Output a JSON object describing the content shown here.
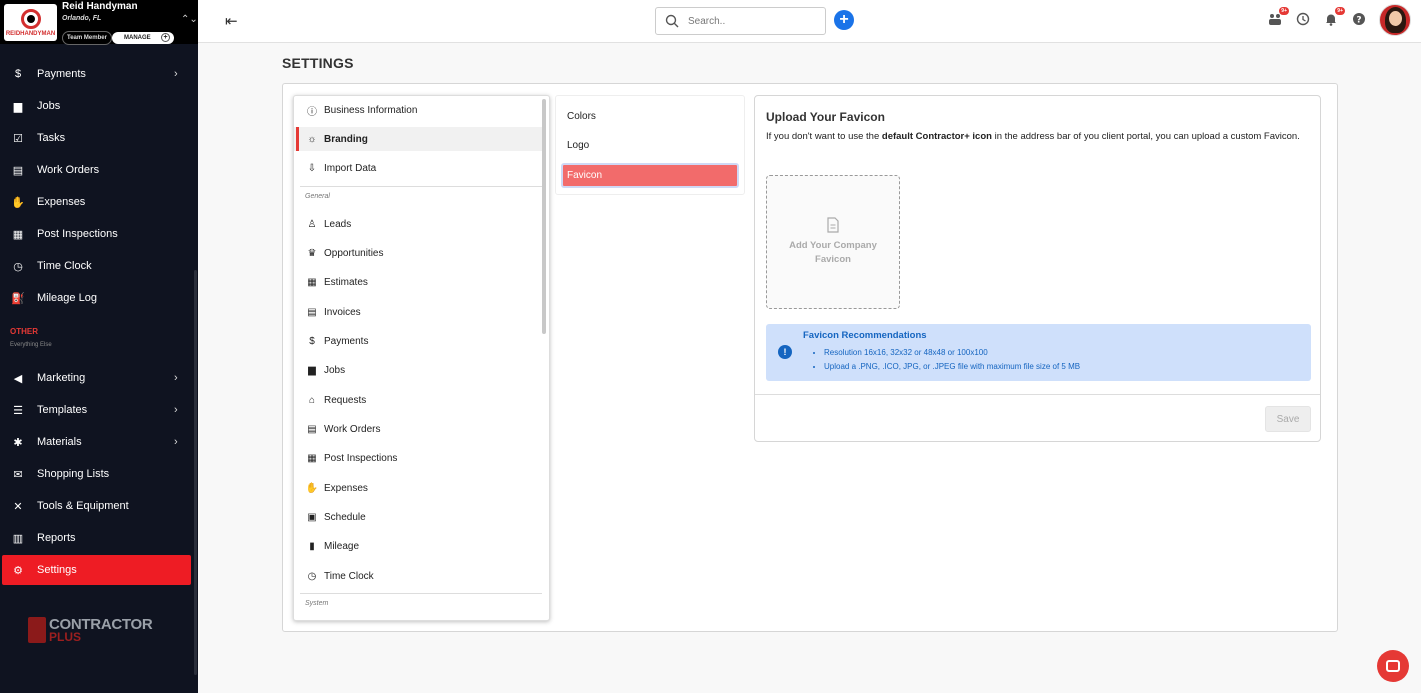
{
  "brand": {
    "name": "Reid Handyman",
    "location": "Orlando, FL",
    "role": "Team Member",
    "manage": "MANAGE",
    "logo_text": "REIDHANDYMAN"
  },
  "sidebar": {
    "items": [
      {
        "label": "Payments",
        "icon": "payments-icon",
        "chevron": true
      },
      {
        "label": "Jobs",
        "icon": "briefcase-icon",
        "chevron": false
      },
      {
        "label": "Tasks",
        "icon": "checklist-icon",
        "chevron": false
      },
      {
        "label": "Work Orders",
        "icon": "work-orders-icon",
        "chevron": false
      },
      {
        "label": "Expenses",
        "icon": "expenses-icon",
        "chevron": false
      },
      {
        "label": "Post Inspections",
        "icon": "inspection-icon",
        "chevron": false
      },
      {
        "label": "Time Clock",
        "icon": "clock-icon",
        "chevron": false
      },
      {
        "label": "Mileage Log",
        "icon": "mileage-icon",
        "chevron": false
      }
    ],
    "other_heading": "OTHER",
    "other_sub": "Everything Else",
    "other_items": [
      {
        "label": "Marketing",
        "icon": "megaphone-icon",
        "chevron": true
      },
      {
        "label": "Templates",
        "icon": "templates-icon",
        "chevron": true
      },
      {
        "label": "Materials",
        "icon": "materials-icon",
        "chevron": true
      },
      {
        "label": "Shopping Lists",
        "icon": "shopping-icon",
        "chevron": false
      },
      {
        "label": "Tools & Equipment",
        "icon": "tools-icon",
        "chevron": false
      },
      {
        "label": "Reports",
        "icon": "reports-icon",
        "chevron": false
      },
      {
        "label": "Settings",
        "icon": "gear-icon",
        "chevron": false,
        "active": true
      }
    ],
    "footer_logo": {
      "line1": "CONTRACTOR",
      "line2": "PLUS"
    }
  },
  "topbar": {
    "search_placeholder": "Search..",
    "badge_1": "9+",
    "badge_2": "9+"
  },
  "page_title": "SETTINGS",
  "settings_menu": {
    "top": [
      {
        "label": "Business Information",
        "icon": "info-icon"
      },
      {
        "label": "Branding",
        "icon": "sun-icon",
        "selected": true
      },
      {
        "label": "Import Data",
        "icon": "import-icon"
      }
    ],
    "general_heading": "General",
    "general": [
      {
        "label": "Leads",
        "icon": "leads-icon"
      },
      {
        "label": "Opportunities",
        "icon": "trophy-icon"
      },
      {
        "label": "Estimates",
        "icon": "calculator-icon"
      },
      {
        "label": "Invoices",
        "icon": "invoice-icon"
      },
      {
        "label": "Payments",
        "icon": "payments-icon"
      },
      {
        "label": "Jobs",
        "icon": "briefcase-icon"
      },
      {
        "label": "Requests",
        "icon": "requests-icon"
      },
      {
        "label": "Work Orders",
        "icon": "work-orders-icon"
      },
      {
        "label": "Post Inspections",
        "icon": "inspection-icon"
      },
      {
        "label": "Expenses",
        "icon": "expenses-icon"
      },
      {
        "label": "Schedule",
        "icon": "calendar-icon"
      },
      {
        "label": "Mileage",
        "icon": "fuel-icon"
      },
      {
        "label": "Time Clock",
        "icon": "clock-icon"
      }
    ],
    "system_heading": "System"
  },
  "branding_tabs": [
    {
      "label": "Colors"
    },
    {
      "label": "Logo"
    },
    {
      "label": "Favicon",
      "selected": true
    }
  ],
  "favicon_panel": {
    "title": "Upload Your Favicon",
    "desc_prefix": "If you don't want to use the ",
    "desc_bold": "default Contractor+ icon",
    "desc_suffix": " in the address bar of you client portal, you can upload a custom Favicon.",
    "upload_label": "Add Your Company Favicon",
    "rec_title": "Favicon Recommendations",
    "rec_1": "Resolution 16x16, 32x32 or 48x48 or 100x100",
    "rec_2": "Upload a .PNG, .ICO, JPG, or .JPEG file with maximum file size of 5 MB",
    "save": "Save"
  },
  "colors": {
    "accent": "#ee1c24",
    "tab_selected": "#f26b6b",
    "info_bg": "#cfe0fb",
    "info_text": "#1565c0",
    "primary_blue": "#1a73e8"
  }
}
